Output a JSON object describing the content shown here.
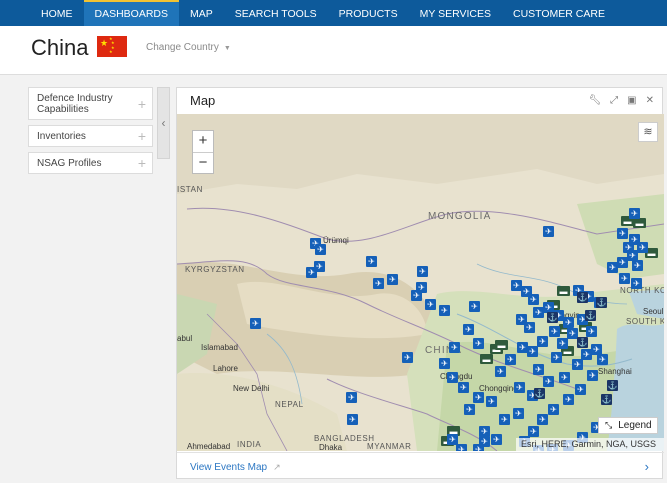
{
  "nav": {
    "items": [
      "HOME",
      "DASHBOARDS",
      "MAP",
      "SEARCH TOOLS",
      "PRODUCTS",
      "MY SERVICES",
      "CUSTOMER CARE"
    ],
    "active": "DASHBOARDS"
  },
  "header": {
    "country": "China",
    "change_country": "Change Country"
  },
  "sidebar": {
    "items": [
      {
        "label": "Defence Industry Capabilities"
      },
      {
        "label": "Inventories"
      },
      {
        "label": "NSAG Profiles"
      }
    ]
  },
  "panel": {
    "title": "Map",
    "tools": [
      "wrench-icon",
      "expand-icon",
      "screen-icon",
      "close-icon"
    ],
    "footer_link": "View Events Map"
  },
  "map": {
    "zoom_in": "+",
    "zoom_out": "−",
    "legend_label": "Legend",
    "attribution": "Esri, HERE, Garmin, NGA, USGS",
    "labels": {
      "istan": "ISTAN",
      "urumqi": "Ürümqi",
      "mongolia": "MONGOLIA",
      "kyrgyzstan": "KYRGYZSTAN",
      "north_korea": "NORTH KOREA",
      "seoul": "Seoul",
      "south_k": "SOUTH K",
      "china": "CHINA",
      "kabul": "abul",
      "islamabad": "Islamabad",
      "lahore": "Lahore",
      "new_delhi": "New Delhi",
      "nepal": "NEPAL",
      "chengdu": "Chengdu",
      "chongqing": "Chongqing",
      "shanghai": "Shanghai",
      "ahmedabad": "Ahmedabad",
      "india": "INDIA",
      "bangladesh": "BANGLADESH",
      "dhaka": "Dhaka",
      "myanmar": "MYANMAR",
      "lingyin": "lingyin"
    }
  },
  "colors": {
    "nav_bg": "#0d5a9b",
    "nav_active": "#1f74b9",
    "accent": "#f1c232",
    "marker_plane": "#1560b8",
    "marker_naval": "#1b3566",
    "marker_ground": "#2f5a3c",
    "flag_red": "#de2910",
    "flag_star": "#ffde00"
  }
}
